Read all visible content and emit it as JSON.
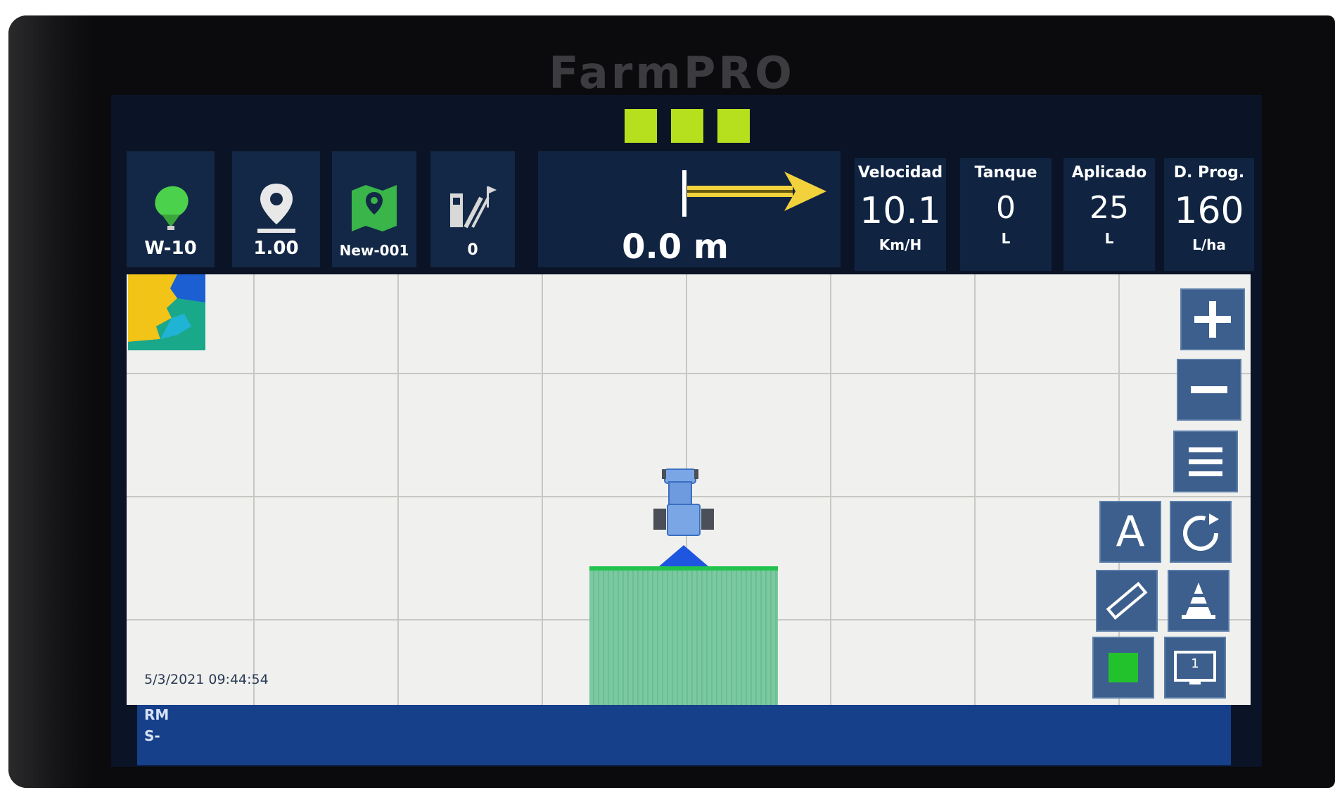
{
  "brand": "FarmPRO",
  "colors": {
    "accent_green": "#b6e01e",
    "tile_bg": "#132846",
    "button_bg": "#3d5f8d",
    "bottom_bar": "#16408a",
    "coverage": "#7bc9a0"
  },
  "status_indicators": 3,
  "tiles": [
    {
      "icon": "gps-satellite-icon",
      "label": "W-10"
    },
    {
      "icon": "location-pin-icon",
      "label": "1.00"
    },
    {
      "icon": "field-map-icon",
      "label": "New-001"
    },
    {
      "icon": "guidance-lines-icon",
      "label": "0"
    }
  ],
  "guidance": {
    "distance": "0.0 m",
    "direction": "right"
  },
  "stats": [
    {
      "title": "Velocidad",
      "value": "10.1",
      "unit": "Km/H"
    },
    {
      "title": "Tanque",
      "value": "0",
      "unit": "L"
    },
    {
      "title": "Aplicado",
      "value": "25",
      "unit": "L"
    },
    {
      "title": "D. Prog.",
      "value": "160",
      "unit": "L/ha"
    }
  ],
  "timestamp": "5/3/2021 09:44:54",
  "bottom_bar": {
    "line1": "RM",
    "line2": "S-"
  },
  "controls": [
    {
      "name": "zoom-in-button",
      "icon": "plus-icon"
    },
    {
      "name": "zoom-out-button",
      "icon": "minus-icon"
    },
    {
      "name": "menu-button",
      "icon": "hamburger-menu-icon"
    },
    {
      "name": "auto-section-button",
      "icon": "letter-a-icon",
      "text": "A"
    },
    {
      "name": "rotate-view-button",
      "icon": "rotate-arrow-icon"
    },
    {
      "name": "measure-button",
      "icon": "ruler-icon"
    },
    {
      "name": "view-perspective-button",
      "icon": "cone-icon"
    },
    {
      "name": "section-toggle-button",
      "icon": "green-square-icon"
    },
    {
      "name": "screen-toggle-button",
      "icon": "monitor-icon",
      "text": "1"
    }
  ]
}
